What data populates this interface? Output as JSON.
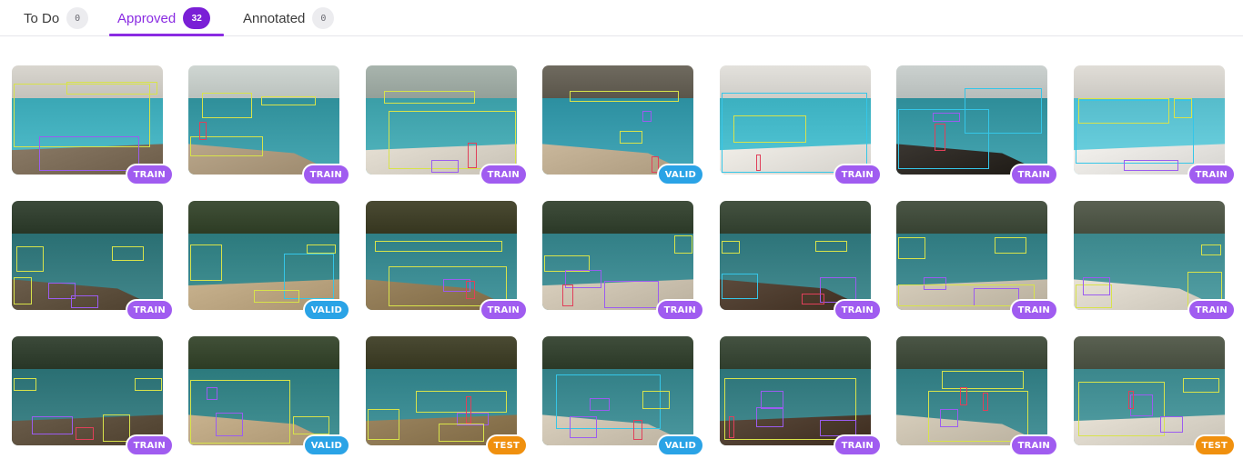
{
  "tabs": [
    {
      "label": "To Do",
      "count": "0",
      "active": false
    },
    {
      "label": "Approved",
      "count": "32",
      "active": true
    },
    {
      "label": "Annotated",
      "count": "0",
      "active": false
    }
  ],
  "colors": {
    "accent": "#8a2be2",
    "train": "#a05cf0",
    "valid": "#2aa3e6",
    "test": "#f0900e",
    "bbox_lounger": "#d8e34a",
    "bbox_towel": "#9b5cf0",
    "bbox_bottle": "#e0405a",
    "bbox_cyan": "#35c6e8"
  },
  "images": [
    {
      "split": "TRAIN",
      "scene": "lounger-closeup"
    },
    {
      "split": "TRAIN",
      "scene": "towel-table"
    },
    {
      "split": "TRAIN",
      "scene": "loungers-row"
    },
    {
      "split": "VALID",
      "scene": "pool-wide"
    },
    {
      "split": "TRAIN",
      "scene": "white-loungers"
    },
    {
      "split": "TRAIN",
      "scene": "deck-row"
    },
    {
      "split": "TRAIN",
      "scene": "teal-towels"
    },
    {
      "split": "TRAIN",
      "scene": "palms-pool"
    },
    {
      "split": "VALID",
      "scene": "palms-loungers"
    },
    {
      "split": "TRAIN",
      "scene": "palms-bright"
    },
    {
      "split": "TRAIN",
      "scene": "palms-towels"
    },
    {
      "split": "TRAIN",
      "scene": "palms-wide"
    },
    {
      "split": "TRAIN",
      "scene": "palms-deck"
    },
    {
      "split": "TRAIN",
      "scene": "palms-left"
    },
    {
      "split": "TRAIN",
      "scene": "palms-center"
    },
    {
      "split": "VALID",
      "scene": "loungers-closeup"
    },
    {
      "split": "TEST",
      "scene": "sunny-loungers"
    },
    {
      "split": "VALID",
      "scene": "blue-pool-loungers"
    },
    {
      "split": "TRAIN",
      "scene": "towel-loungers"
    },
    {
      "split": "TRAIN",
      "scene": "lounger-side"
    },
    {
      "split": "TEST",
      "scene": "lounger-right"
    }
  ]
}
